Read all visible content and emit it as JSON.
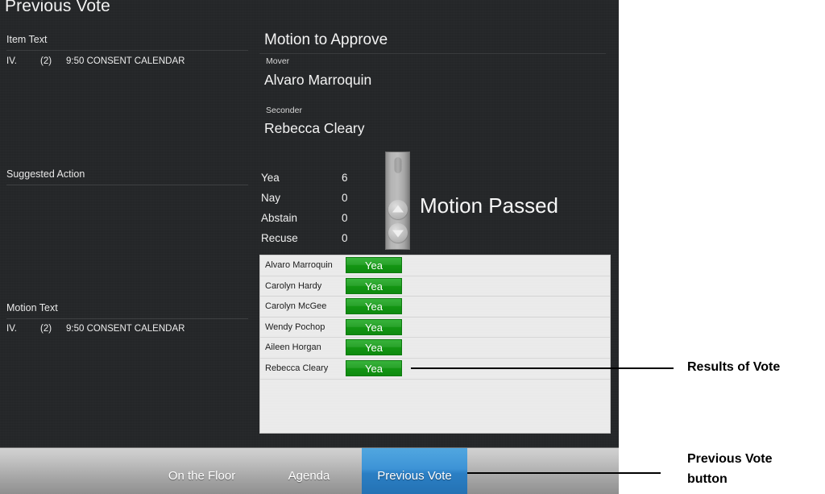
{
  "app": {
    "title": "Previous Vote"
  },
  "left_panel": {
    "item_text": {
      "label": "Item Text",
      "number": "IV.",
      "paren": "(2)",
      "text": "9:50 CONSENT CALENDAR"
    },
    "suggested_action": {
      "label": "Suggested Action",
      "text": ""
    },
    "motion_text": {
      "label": "Motion Text",
      "number": "IV.",
      "paren": "(2)",
      "text": "9:50 CONSENT CALENDAR"
    }
  },
  "motion": {
    "title": "Motion to Approve",
    "mover_label": "Mover",
    "mover_name": "Alvaro Marroquin",
    "seconder_label": "Seconder",
    "seconder_name": "Rebecca Cleary"
  },
  "tally": {
    "rows": [
      {
        "label": "Yea",
        "value": "6"
      },
      {
        "label": "Nay",
        "value": "0"
      },
      {
        "label": "Abstain",
        "value": "0"
      },
      {
        "label": "Recuse",
        "value": "0"
      }
    ]
  },
  "result": {
    "banner": "Motion Passed"
  },
  "vote_results": {
    "rows": [
      {
        "name": "Alvaro Marroquin",
        "vote": "Yea"
      },
      {
        "name": "Carolyn Hardy",
        "vote": "Yea"
      },
      {
        "name": "Carolyn McGee",
        "vote": "Yea"
      },
      {
        "name": "Wendy Pochop",
        "vote": "Yea"
      },
      {
        "name": "Aileen Horgan",
        "vote": "Yea"
      },
      {
        "name": "Rebecca Cleary",
        "vote": "Yea"
      }
    ]
  },
  "tabs": {
    "on_the_floor": "On the Floor",
    "agenda": "Agenda",
    "previous_vote": "Previous Vote"
  },
  "annotations": {
    "results_of_vote": "Results of Vote",
    "previous_vote_button": "Previous Vote\nbutton"
  },
  "colors": {
    "app_background": "#222426",
    "yea_green": "#2aa32c",
    "active_tab_blue": "#3d93d6",
    "results_panel": "#ececec"
  }
}
